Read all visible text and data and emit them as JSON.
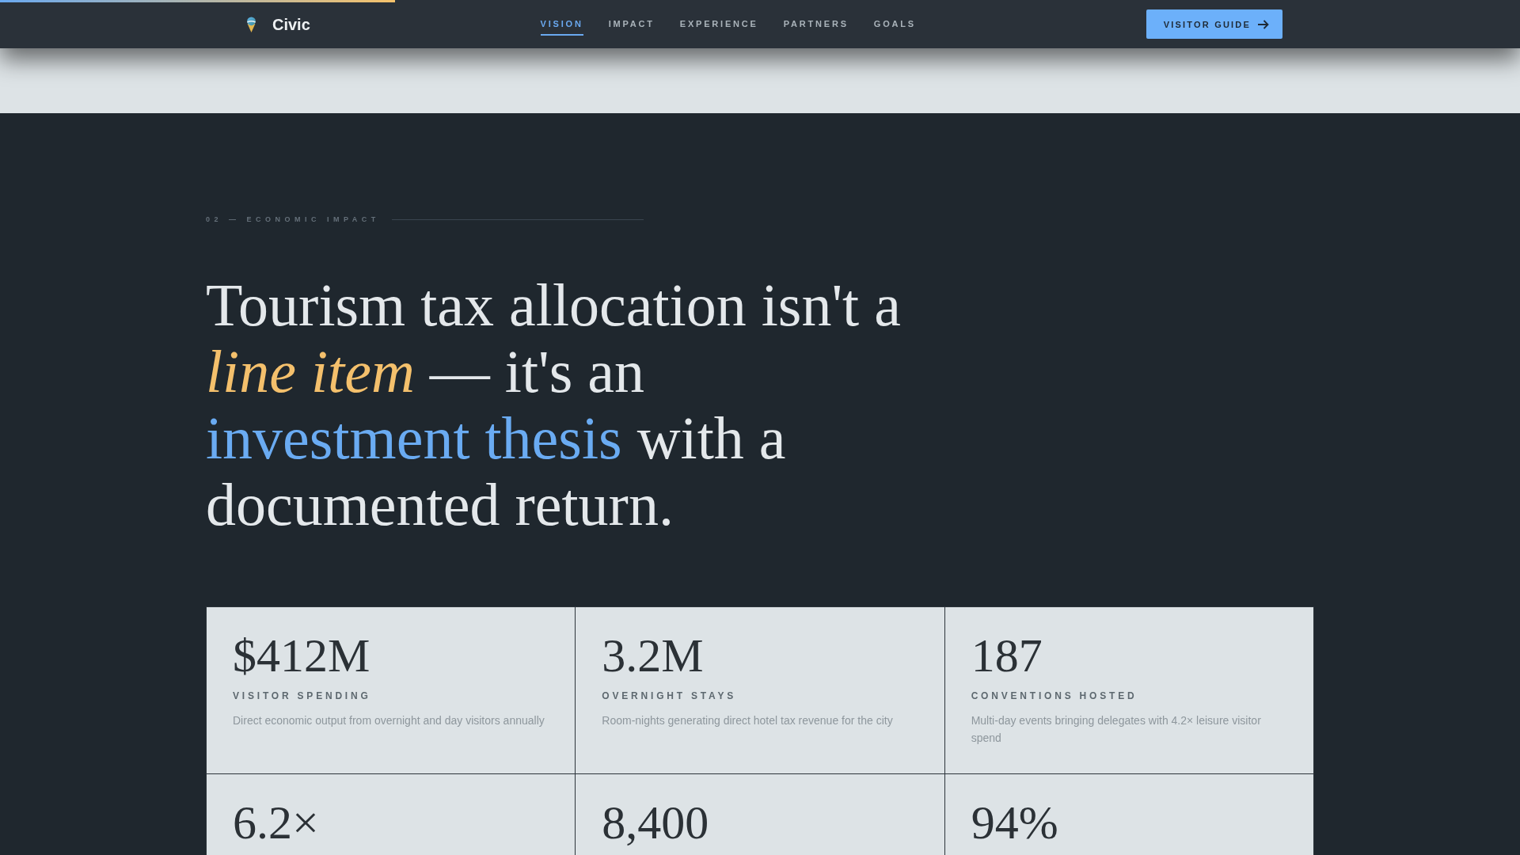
{
  "scroll_progress": {
    "level": 0.26
  },
  "nav": {
    "brand": "Civic",
    "links": [
      {
        "label": "VISION",
        "selected": true
      },
      {
        "label": "IMPACT",
        "selected": false
      },
      {
        "label": "EXPERIENCE",
        "selected": false
      },
      {
        "label": "PARTNERS",
        "selected": false
      },
      {
        "label": "GOALS",
        "selected": false
      }
    ],
    "cta": {
      "label": "VISITOR GUIDE"
    }
  },
  "section": {
    "eyebrow": "02 — ECONOMIC IMPACT",
    "headline": [
      [
        {
          "text": "Tourism tax allocation isn't a",
          "kind": "plain"
        }
      ],
      [
        {
          "text": "line item",
          "kind": "accent"
        },
        {
          "text": " — it's an",
          "kind": "plain"
        }
      ],
      [
        {
          "text": "investment thesis",
          "kind": "highlight"
        },
        {
          "text": " with a",
          "kind": "plain"
        }
      ],
      [
        {
          "text": "documented return.",
          "kind": "plain"
        }
      ]
    ],
    "stats": [
      {
        "value": "$412M",
        "label": "VISITOR SPENDING",
        "description": "Direct economic output from overnight and day visitors annually"
      },
      {
        "value": "3.2M",
        "label": "OVERNIGHT STAYS",
        "description": "Room-nights generating direct hotel tax revenue for the city"
      },
      {
        "value": "187",
        "label": "CONVENTIONS HOSTED",
        "description": "Multi-day events bringing delegates with 4.2× leisure visitor spend"
      },
      {
        "value": "6.2×"
      },
      {
        "value": "8,400"
      },
      {
        "value": "94%"
      }
    ]
  }
}
